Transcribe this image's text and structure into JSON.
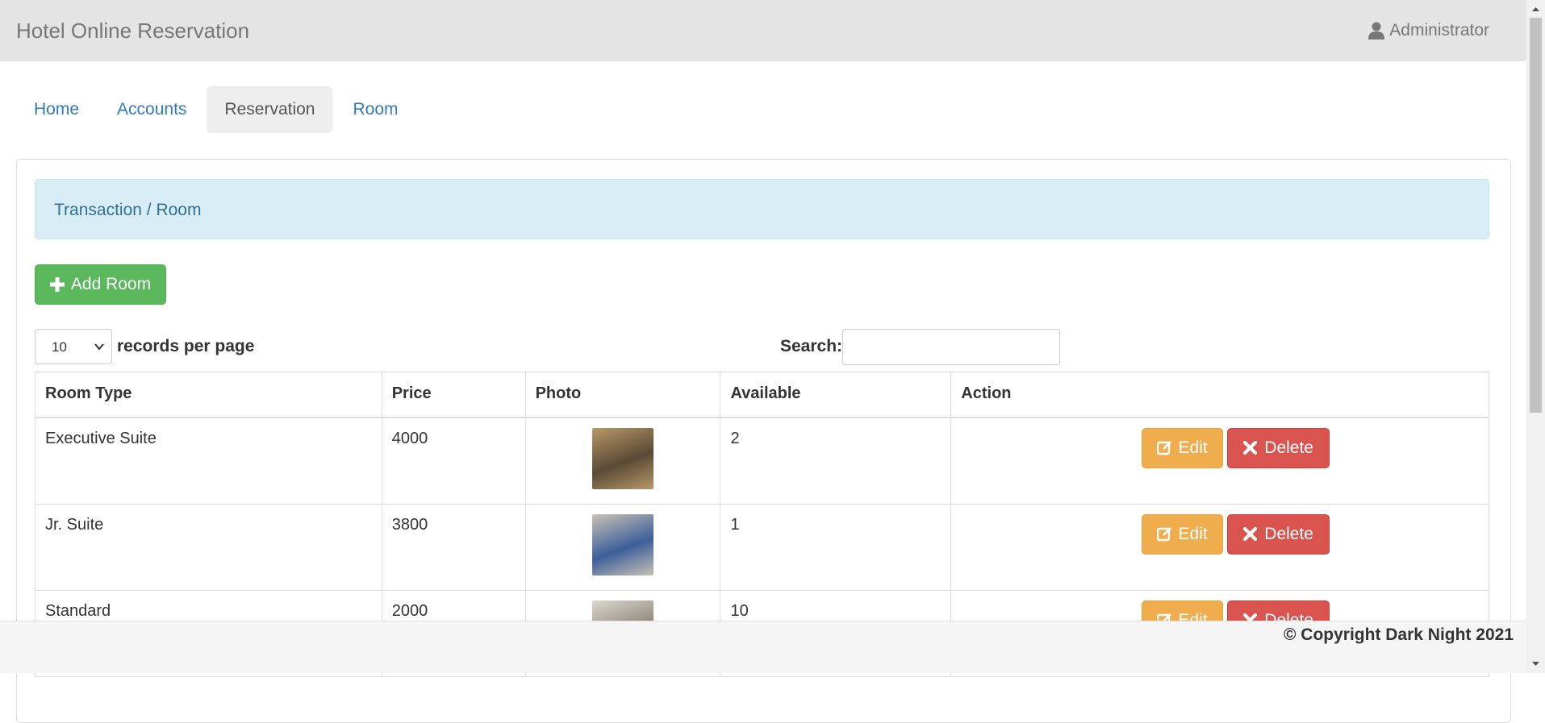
{
  "navbar": {
    "brand": "Hotel Online Reservation",
    "user": "Administrator",
    "user_icon": "user-icon"
  },
  "tabs": [
    {
      "label": "Home",
      "active": false
    },
    {
      "label": "Accounts",
      "active": false
    },
    {
      "label": "Reservation",
      "active": true
    },
    {
      "label": "Room",
      "active": false
    }
  ],
  "breadcrumb": "Transaction / Room",
  "add_button": {
    "label": "Add Room",
    "icon": "plus-icon"
  },
  "table_controls": {
    "page_length": "10",
    "length_label": "records per page",
    "search_label": "Search:",
    "search_value": ""
  },
  "columns": [
    "Room Type",
    "Price",
    "Photo",
    "Available",
    "Action"
  ],
  "rows": [
    {
      "room_type": "Executive Suite",
      "price": "4000",
      "available": "2",
      "photo_colors": [
        "#5a4a35",
        "#b89868"
      ]
    },
    {
      "room_type": "Jr. Suite",
      "price": "3800",
      "available": "1",
      "photo_colors": [
        "#3d5f9a",
        "#c9c2b5"
      ]
    },
    {
      "room_type": "Standard",
      "price": "2000",
      "available": "10",
      "photo_colors": [
        "#8c8478",
        "#dcd8d0"
      ]
    }
  ],
  "row_actions": {
    "edit": "Edit",
    "delete": "Delete",
    "edit_icon": "edit-icon",
    "delete_icon": "close-icon"
  },
  "footer": {
    "text": "© Copyright Dark Night 2021"
  },
  "colors": {
    "success": "#5cb85c",
    "warning": "#f0ad4e",
    "danger": "#d9534f",
    "link": "#337ab7"
  }
}
